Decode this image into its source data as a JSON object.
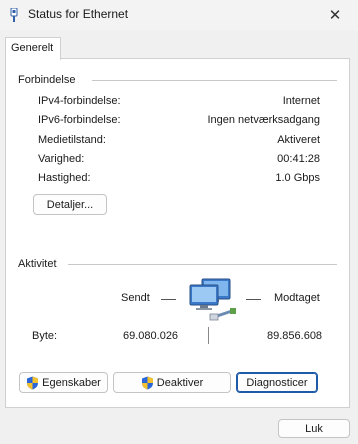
{
  "window": {
    "title": "Status for Ethernet",
    "close_glyph": "✕"
  },
  "tabs": [
    {
      "label": "Generelt"
    }
  ],
  "connection": {
    "group_title": "Forbindelse",
    "rows": [
      {
        "label": "IPv4-forbindelse:",
        "value": "Internet"
      },
      {
        "label": "IPv6-forbindelse:",
        "value": "Ingen netværksadgang"
      },
      {
        "label": "Medietilstand:",
        "value": "Aktiveret"
      },
      {
        "label": "Varighed:",
        "value": "00:41:28"
      },
      {
        "label": "Hastighed:",
        "value": "1.0 Gbps"
      }
    ],
    "details_button": "Detaljer..."
  },
  "activity": {
    "group_title": "Aktivitet",
    "sent_label": "Sendt",
    "received_label": "Modtaget",
    "bytes_label": "Byte:",
    "bytes_sent": "69.080.026",
    "bytes_received": "89.856.608",
    "icon": "network-computers-icon"
  },
  "buttons": {
    "properties": "Egenskaber",
    "disable": "Deaktiver",
    "diagnose": "Diagnosticer",
    "close": "Luk"
  },
  "colors": {
    "shield_blue": "#2a66d9",
    "shield_yellow": "#f2c12e",
    "focus_border": "#1e5aa8"
  }
}
